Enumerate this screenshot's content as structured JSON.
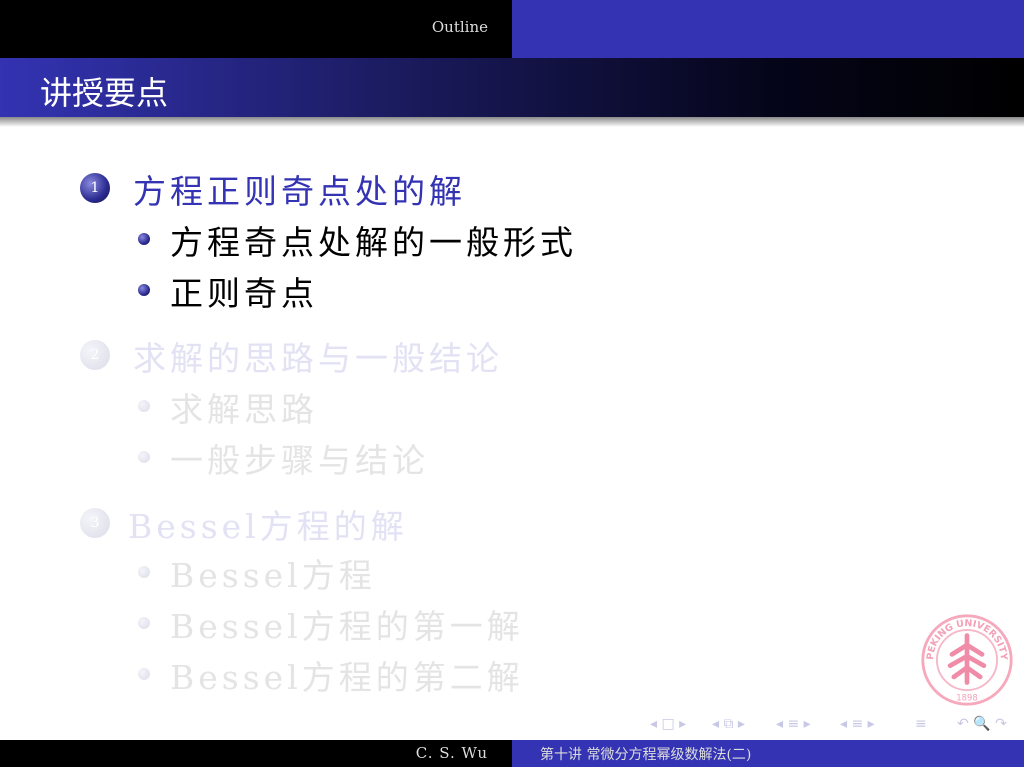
{
  "header": {
    "section": "Outline"
  },
  "frame_title": "讲授要点",
  "sections": [
    {
      "number": "1",
      "title": "方程正则奇点处的解",
      "state": "active",
      "items": [
        "方程奇点处解的一般形式",
        "正则奇点"
      ]
    },
    {
      "number": "2",
      "title": "求解的思路与一般结论",
      "state": "faded",
      "items": [
        "求解思路",
        "一般步骤与结论"
      ]
    },
    {
      "number": "3",
      "title": "Bessel方程的解",
      "state": "faded",
      "items": [
        "Bessel方程",
        "Bessel方程的第一解",
        "Bessel方程的第二解"
      ]
    }
  ],
  "logo": {
    "text": "PEKING UNIVERSITY",
    "year": "1898"
  },
  "nav": {
    "frame": "◂ □ ▸",
    "subsection": "◂ ⧉ ▸",
    "section": "◂ ≡ ▸",
    "subsec2": "◂ ≡ ▸",
    "doc": "≡",
    "search": "↶ 🔍 ↷"
  },
  "footer": {
    "author": "C. S. Wu",
    "title": "第十讲  常微分方程幂级数解法(二)"
  },
  "colors": {
    "structure": "#3333b3",
    "logo": "#f08ca8"
  }
}
